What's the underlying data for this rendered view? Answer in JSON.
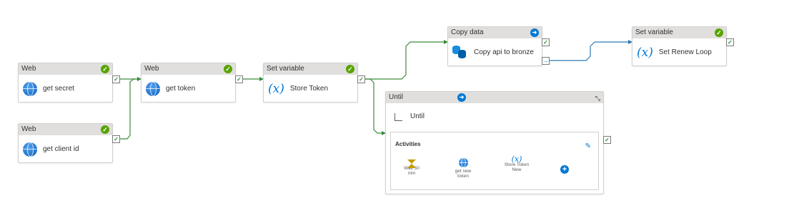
{
  "activities": {
    "get_secret": {
      "type": "Web",
      "name": "get secret"
    },
    "get_client_id": {
      "type": "Web",
      "name": "get client id"
    },
    "get_token": {
      "type": "Web",
      "name": "get token"
    },
    "store_token": {
      "type": "Set variable",
      "name": "Store Token"
    },
    "copy_data": {
      "type": "Copy data",
      "name": "Copy api to bronze"
    },
    "set_renew_loop": {
      "type": "Set variable",
      "name": "Set Renew Loop"
    },
    "until": {
      "type": "Until",
      "name": "Until",
      "activities_title": "Activities",
      "steps": [
        {
          "label": "Wait 50 min"
        },
        {
          "label": "get new token"
        },
        {
          "label": "Store Token New"
        }
      ]
    }
  },
  "icons": {
    "success": "check-circle-icon",
    "running": "run-icon",
    "web": "globe-icon",
    "variable": "fx-icon",
    "copy": "database-icon",
    "wait": "hourglass-icon",
    "add": "plus-icon",
    "edit": "pencil-icon",
    "expand": "expand-icon"
  },
  "colors": {
    "success_green": "#57a300",
    "accent_blue": "#0078d4",
    "success_line": "#3c8c3c",
    "completion_line": "#2e7ab8",
    "header_bg": "#e1dfdd"
  }
}
